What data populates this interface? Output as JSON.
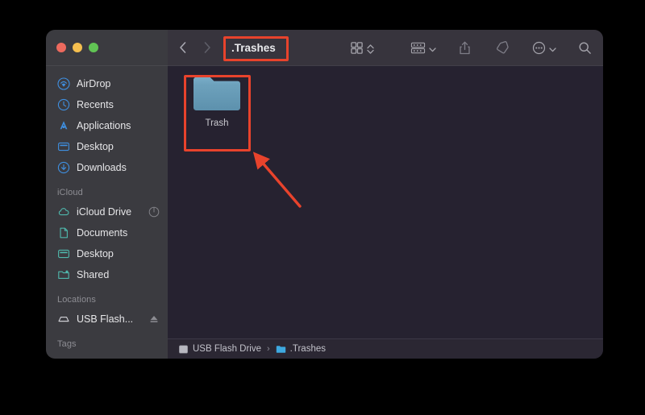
{
  "window": {
    "traffic_lights": [
      {
        "name": "close",
        "color": "#ed6a5e"
      },
      {
        "name": "minimize",
        "color": "#f5bf4f"
      },
      {
        "name": "zoom",
        "color": "#61c454"
      }
    ]
  },
  "toolbar": {
    "back_label": "Back",
    "forward_label": "Forward",
    "title": ".Trashes",
    "view_icon": "grid-view-icon",
    "view_chevron": "chevron-updown-icon",
    "group_icon": "group-by-icon",
    "group_chevron": "chevron-down-icon",
    "share_icon": "share-icon",
    "tag_icon": "tag-icon",
    "more_icon": "ellipsis-circle-icon",
    "more_chevron": "chevron-down-icon",
    "search_icon": "search-icon"
  },
  "sidebar": {
    "favorites": [
      {
        "label": "AirDrop",
        "icon": "airdrop-icon"
      },
      {
        "label": "Recents",
        "icon": "clock-icon"
      },
      {
        "label": "Applications",
        "icon": "applications-icon"
      },
      {
        "label": "Desktop",
        "icon": "desktop-icon"
      },
      {
        "label": "Downloads",
        "icon": "downloads-icon"
      }
    ],
    "icloud_header": "iCloud",
    "icloud": [
      {
        "label": "iCloud Drive",
        "icon": "cloud-icon",
        "trailing": "sync-progress-icon"
      },
      {
        "label": "Documents",
        "icon": "document-icon",
        "trailing": ""
      },
      {
        "label": "Desktop",
        "icon": "desktop-icon",
        "trailing": ""
      },
      {
        "label": "Shared",
        "icon": "shared-folder-icon",
        "trailing": ""
      }
    ],
    "locations_header": "Locations",
    "locations": [
      {
        "label": "USB Flash...",
        "icon": "external-drive-icon",
        "trailing": "eject-icon"
      }
    ],
    "tags_header": "Tags"
  },
  "content": {
    "items": [
      {
        "label": "Trash",
        "icon": "folder-icon"
      }
    ]
  },
  "statusbar": {
    "breadcrumb": [
      {
        "label": "USB Flash Drive",
        "icon": "drive-icon"
      },
      {
        "label": ".Trashes",
        "icon": "blue-folder-icon"
      }
    ],
    "separator": "›"
  },
  "annotations": {
    "accent_color": "#e8432c",
    "title_highlight": ".Trashes",
    "item_highlight": "Trash",
    "arrow": "red-arrow-pointing-to-trash-folder"
  }
}
